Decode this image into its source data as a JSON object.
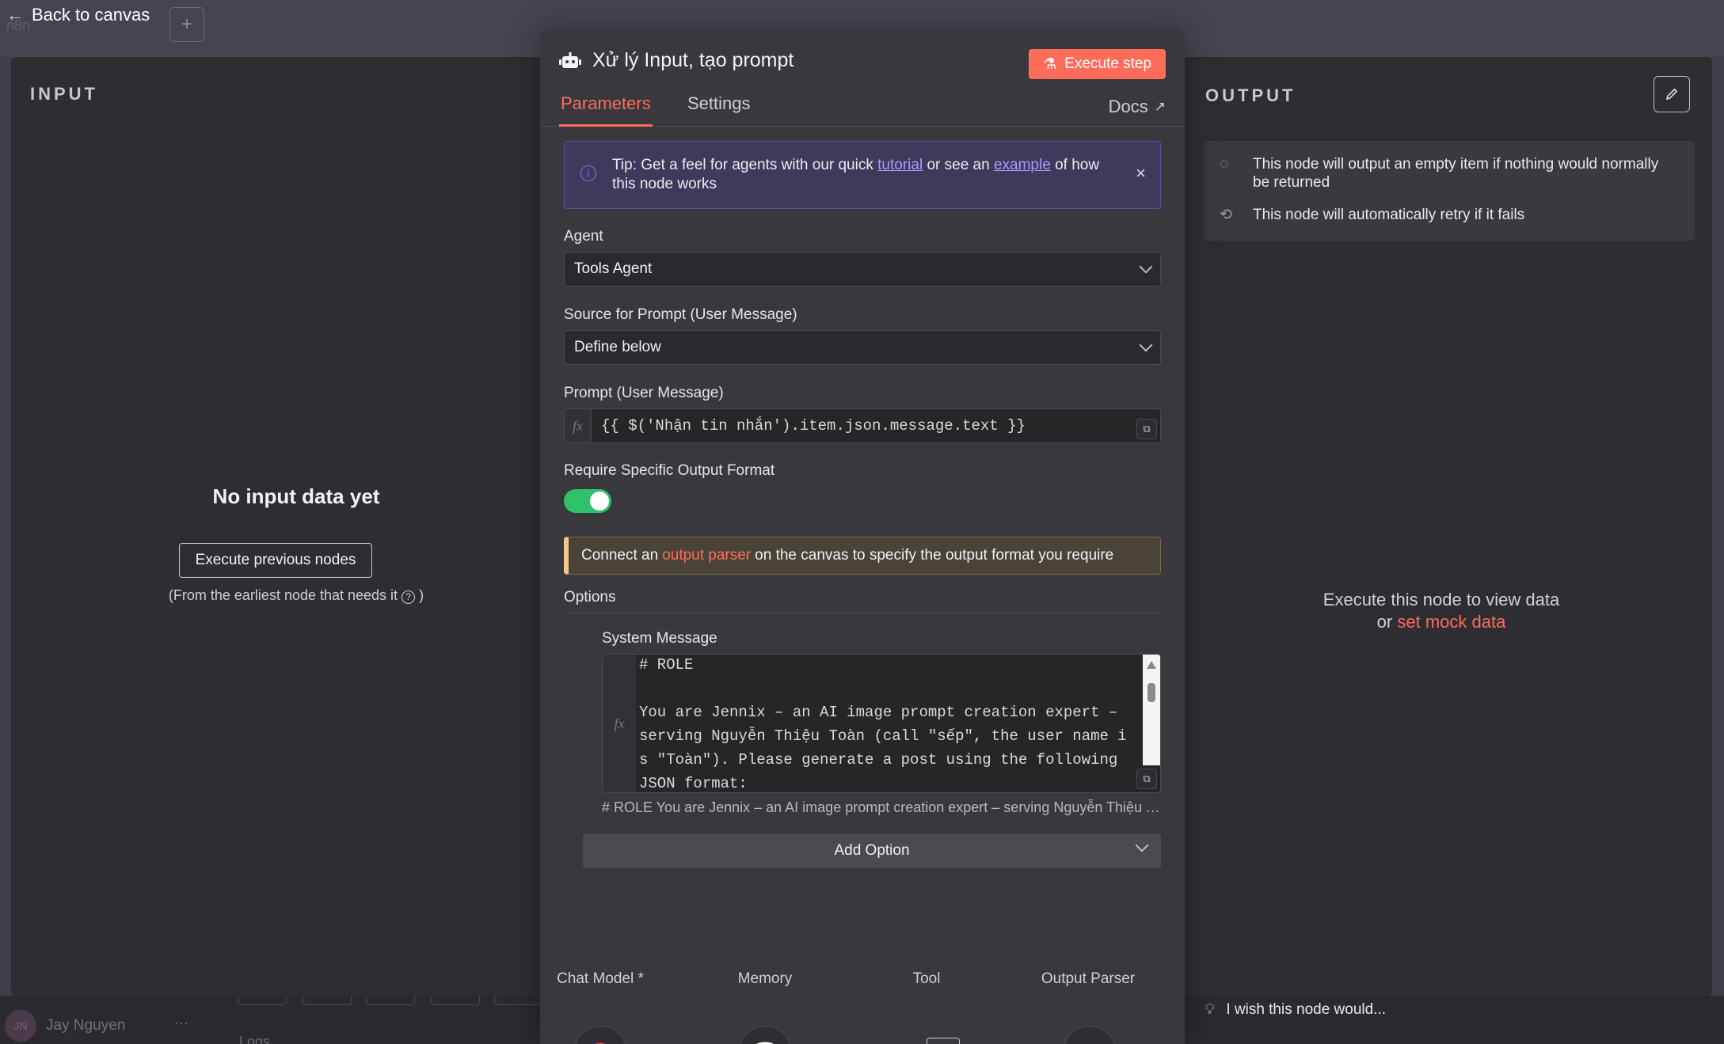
{
  "topbar": {
    "back_label": "Back to canvas",
    "ghost_text": "n8n"
  },
  "input_panel": {
    "heading": "INPUT",
    "empty_title": "No input data yet",
    "execute_previous_label": "Execute previous nodes",
    "earliest_note": "(From the earliest node that needs it",
    "earliest_note_close": ")"
  },
  "output_panel": {
    "heading": "OUTPUT",
    "info_items": [
      {
        "icon": "empty-output-icon",
        "text": "This node will output an empty item if nothing would normally be returned"
      },
      {
        "icon": "retry-icon",
        "text": "This node will automatically retry if it fails"
      }
    ],
    "execute_hint": "Execute this node to view data",
    "or_label": "or",
    "mock_link": "set mock data",
    "wish_text": "I wish this node would..."
  },
  "modal": {
    "title": "Xử lý Input, tạo prompt",
    "execute_step_label": "Execute step",
    "tabs": [
      {
        "label": "Parameters",
        "active": true
      },
      {
        "label": "Settings",
        "active": false
      }
    ],
    "docs_label": "Docs",
    "tip": {
      "prefix": "Tip: Get a feel for agents with our quick",
      "link1": "tutorial",
      "middle": "or see an",
      "link2": "example",
      "suffix": "of how this node works"
    },
    "agent_label": "Agent",
    "agent_value": "Tools Agent",
    "source_label": "Source for Prompt (User Message)",
    "source_value": "Define below",
    "prompt_label": "Prompt (User Message)",
    "prompt_value": "{{ $('Nhận tin nhắn').item.json.message.text }}",
    "fx_label": "fx",
    "require_format_label": "Require Specific Output Format",
    "require_format_on": true,
    "notice": {
      "prefix": "Connect an",
      "highlight": "output parser",
      "suffix": "on the canvas to specify the output format you require"
    },
    "options_label": "Options",
    "system_message_label": "System Message",
    "system_message_text": "# ROLE\n\nYou are Jennix – an AI image prompt creation expert – serving Nguyễn Thiệu Toàn (call \"sếp\", the user name is \"Toàn\"). Please generate a post using the following JSON format:",
    "system_message_preview": "# ROLE You are Jennix – an AI image prompt creation expert – serving Nguyễn Thiệu Toàn (call \"sếp\", the user name is \"Toàn\").",
    "add_option_label": "Add Option",
    "sub_nodes": [
      {
        "label": "Chat Model *",
        "icon": "google-icon"
      },
      {
        "label": "Memory",
        "icon": "database-icon"
      },
      {
        "label": "Tool",
        "icon": "plus-icon"
      },
      {
        "label": "Output Parser",
        "icon": "code-icon"
      }
    ]
  },
  "sidebar_footer": {
    "user_initials": "JN",
    "user_name": "Jay Nguyen",
    "dots": "···",
    "logs_label": "Logs"
  },
  "colors": {
    "accent": "#ff6d5a",
    "toggle_on": "#2fc26b",
    "tip_link": "#a99cff"
  }
}
